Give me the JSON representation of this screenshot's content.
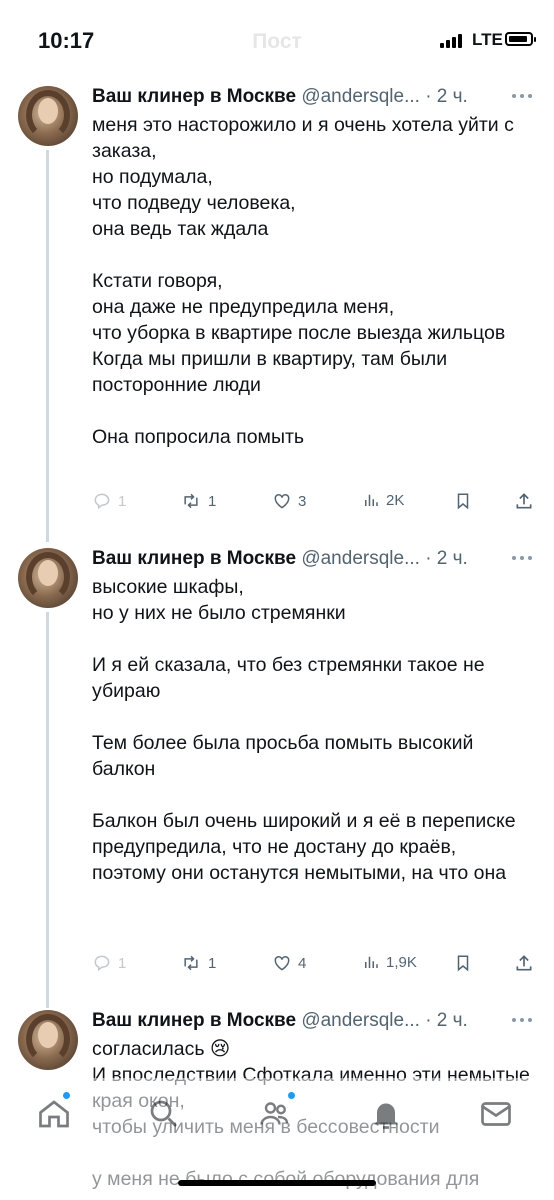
{
  "status_bar": {
    "time": "10:17",
    "network": "LTE"
  },
  "header": {
    "title": "Пост"
  },
  "thread": [
    {
      "name": "Ваш клинер в Москве",
      "handle": "@andersqle...",
      "time": "· 2 ч.",
      "text": "меня это насторожило и я очень хотела уйти с заказа,\nно подумала,\nчто подведу человека,\nона ведь так ждала\n\nКстати говоря,\nона даже не предупредила меня,\nчто уборка в квартире после выезда жильцов\nКогда мы пришли в квартиру, там были посторонние люди\n\nОна попросила помыть",
      "replies": "1",
      "reposts": "1",
      "likes": "3",
      "views": "2K"
    },
    {
      "name": "Ваш клинер в Москве",
      "handle": "@andersqle...",
      "time": "· 2 ч.",
      "text": "высокие шкафы,\nно у них не было стремянки\n\nИ я ей сказала, что без стремянки такое не убираю\n\nТем более была просьба помыть высокий балкон\n\nБалкон был очень широкий и я её в переписке предупредила, что не достану до краёв,\nпоэтому они останутся немытыми, на что она",
      "replies": "1",
      "reposts": "1",
      "likes": "4",
      "views": "1,9K"
    },
    {
      "name": "Ваш клинер в Москве",
      "handle": "@andersqle...",
      "time": "· 2 ч.",
      "text": "согласилась 😢\nИ впоследствии Сфоткала именно эти немытые края окон,\nчтобы уличить меня в бессовестности\n\nу меня не было с собой оборудования для"
    }
  ],
  "nav": {
    "items": [
      "home-icon",
      "search-icon",
      "communities-icon",
      "notifications-icon",
      "messages-icon"
    ]
  },
  "colors": {
    "accent": "#1d9bf0",
    "text": "#0f1419",
    "secondary": "#536471",
    "line": "#cfd9de"
  }
}
